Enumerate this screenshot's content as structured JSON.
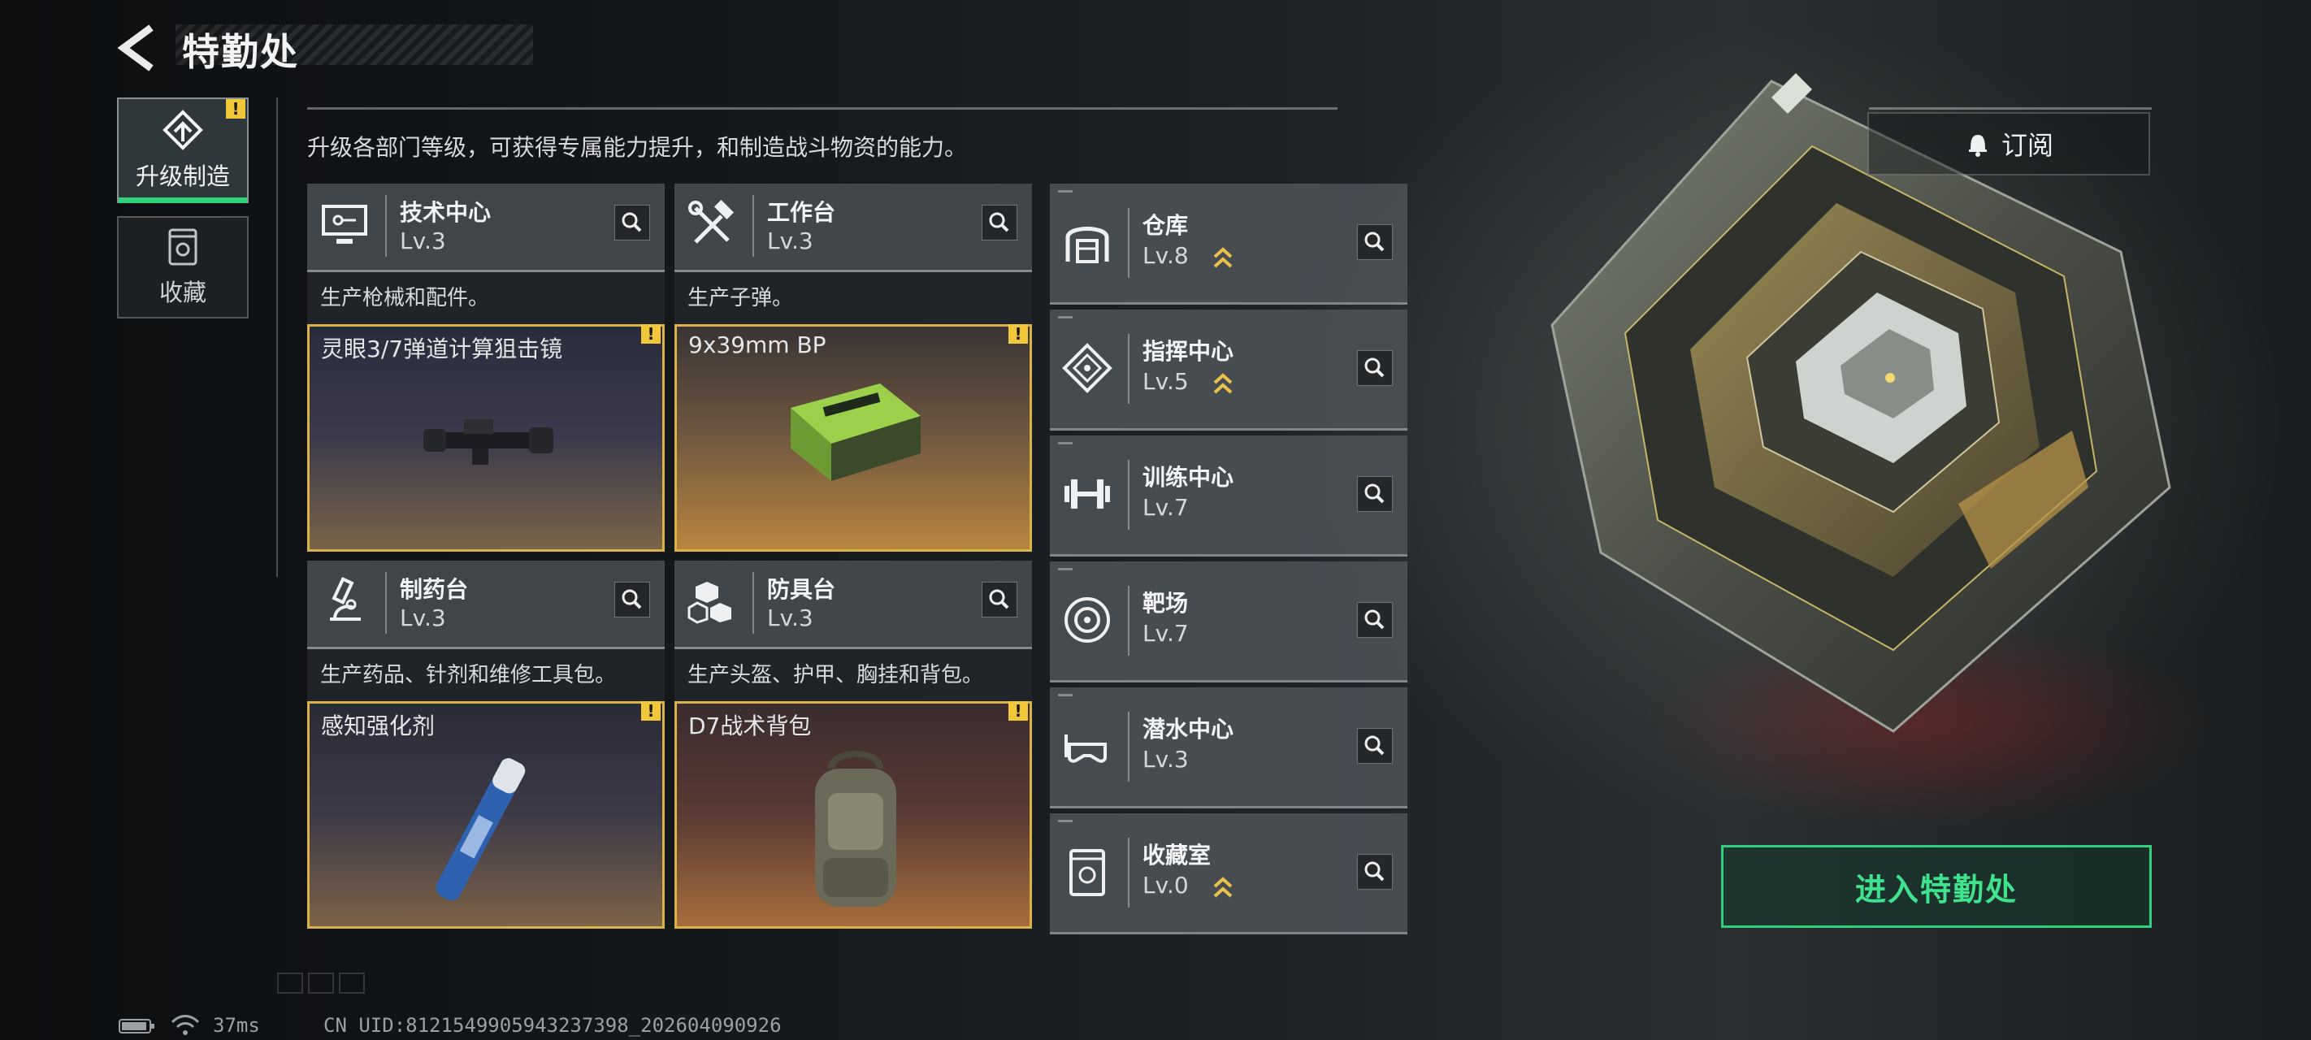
{
  "header": {
    "title": "特勤处"
  },
  "subtitle": "升级各部门等级，可获得专属能力提升，和制造战斗物资的能力。",
  "nav": [
    {
      "label": "升级制造",
      "active": true,
      "alert": "!"
    },
    {
      "label": "收藏",
      "active": false
    }
  ],
  "departments": [
    {
      "name": "技术中心",
      "level": "Lv.3",
      "desc": "生产枪械和配件。",
      "product": "灵眼3/7弹道计算狙击镜",
      "alert": "!"
    },
    {
      "name": "工作台",
      "level": "Lv.3",
      "desc": "生产子弹。",
      "product": "9x39mm BP",
      "alert": "!"
    },
    {
      "name": "制药台",
      "level": "Lv.3",
      "desc": "生产药品、针剂和维修工具包。",
      "product": "感知强化剂",
      "alert": "!"
    },
    {
      "name": "防具台",
      "level": "Lv.3",
      "desc": "生产头盔、护甲、胸挂和背包。",
      "product": "D7战术背包",
      "alert": "!"
    }
  ],
  "facilities": [
    {
      "name": "仓库",
      "level": "Lv.8",
      "upgradable": true
    },
    {
      "name": "指挥中心",
      "level": "Lv.5",
      "upgradable": true
    },
    {
      "name": "训练中心",
      "level": "Lv.7",
      "upgradable": false
    },
    {
      "name": "靶场",
      "level": "Lv.7",
      "upgradable": false
    },
    {
      "name": "潜水中心",
      "level": "Lv.3",
      "upgradable": false
    },
    {
      "name": "收藏室",
      "level": "Lv.0",
      "upgradable": true
    }
  ],
  "buttons": {
    "subscribe": "订阅",
    "enter": "进入特勤处"
  },
  "status": {
    "ping": "37ms",
    "uid": "CN UID:81215499059432373​98_202604090926"
  },
  "colors": {
    "accent_green": "#2fd07a",
    "alert_yellow": "#f3c73a",
    "card_border": "#d9b34a"
  }
}
